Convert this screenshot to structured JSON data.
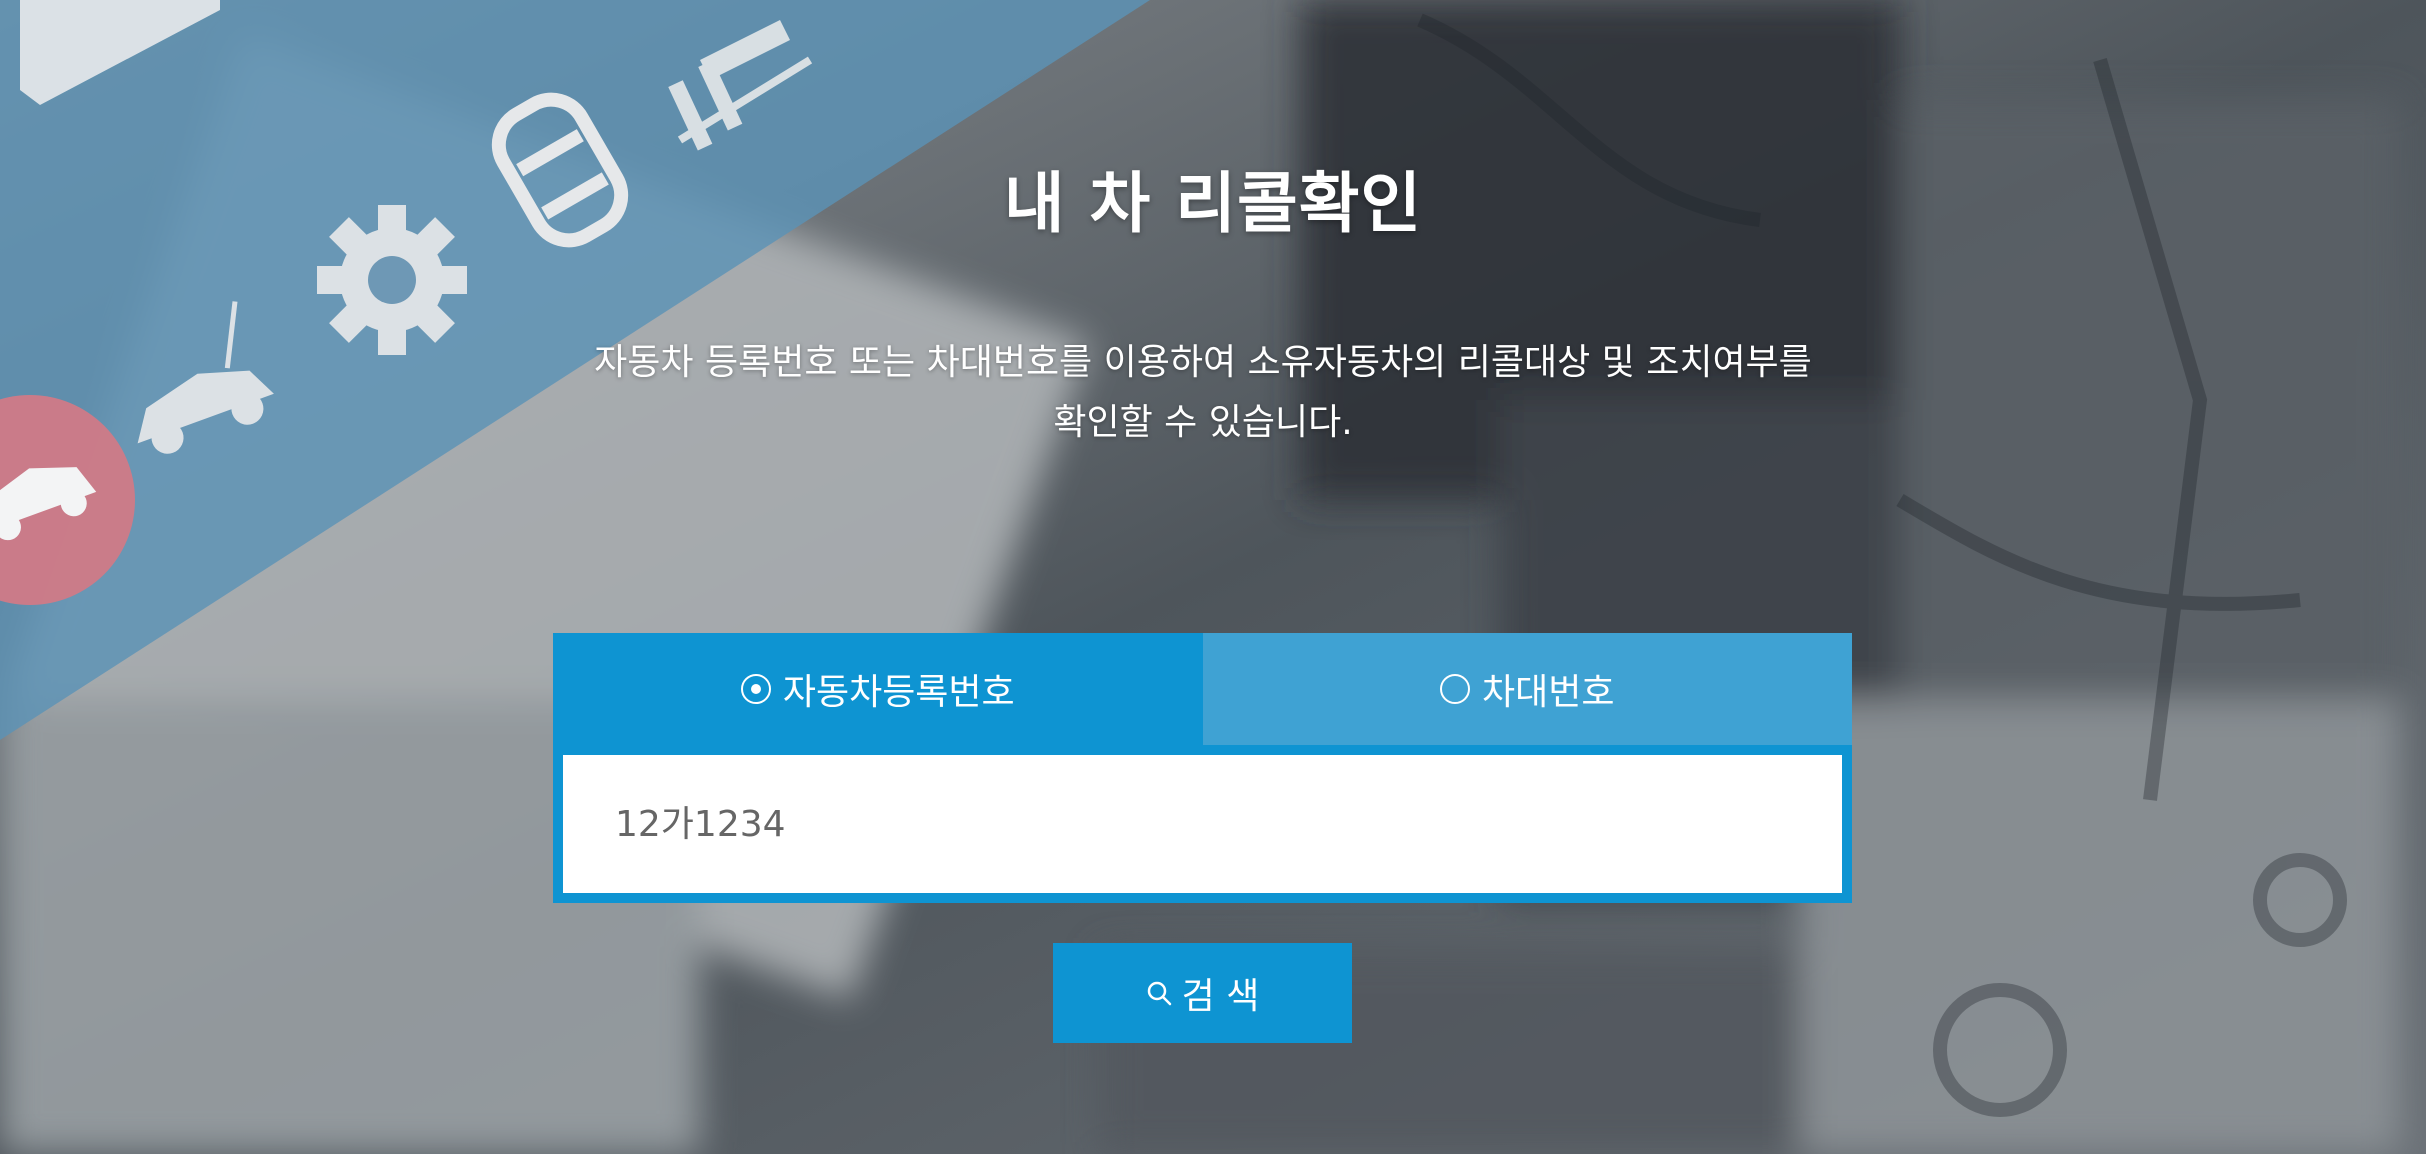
{
  "page": {
    "title": "내 차 리콜확인",
    "description_line1": "자동차 등록번호 또는 차대번호를 이용하여 소유자동차의 리콜대상 및 조치여부를",
    "description_line2": "확인할 수 있습니다."
  },
  "tabs": [
    {
      "label": "자동차등록번호",
      "selected": true,
      "icon": "radio-selected-icon"
    },
    {
      "label": "차대번호",
      "selected": false,
      "icon": "radio-unselected-icon"
    }
  ],
  "search": {
    "placeholder": "12가1234",
    "button_label": "검 색",
    "button_icon": "search-icon"
  },
  "colors": {
    "accent": "#0e94d2",
    "tab_inactive": "#3fa2d3",
    "banner_blue": "#5b93b6",
    "highlight_pink": "#d07a87"
  },
  "background_icons": [
    "document-icon",
    "car-slide-icon",
    "car-top-icon",
    "gear-icon",
    "car-antenna-icon",
    "car-alert-icon"
  ]
}
